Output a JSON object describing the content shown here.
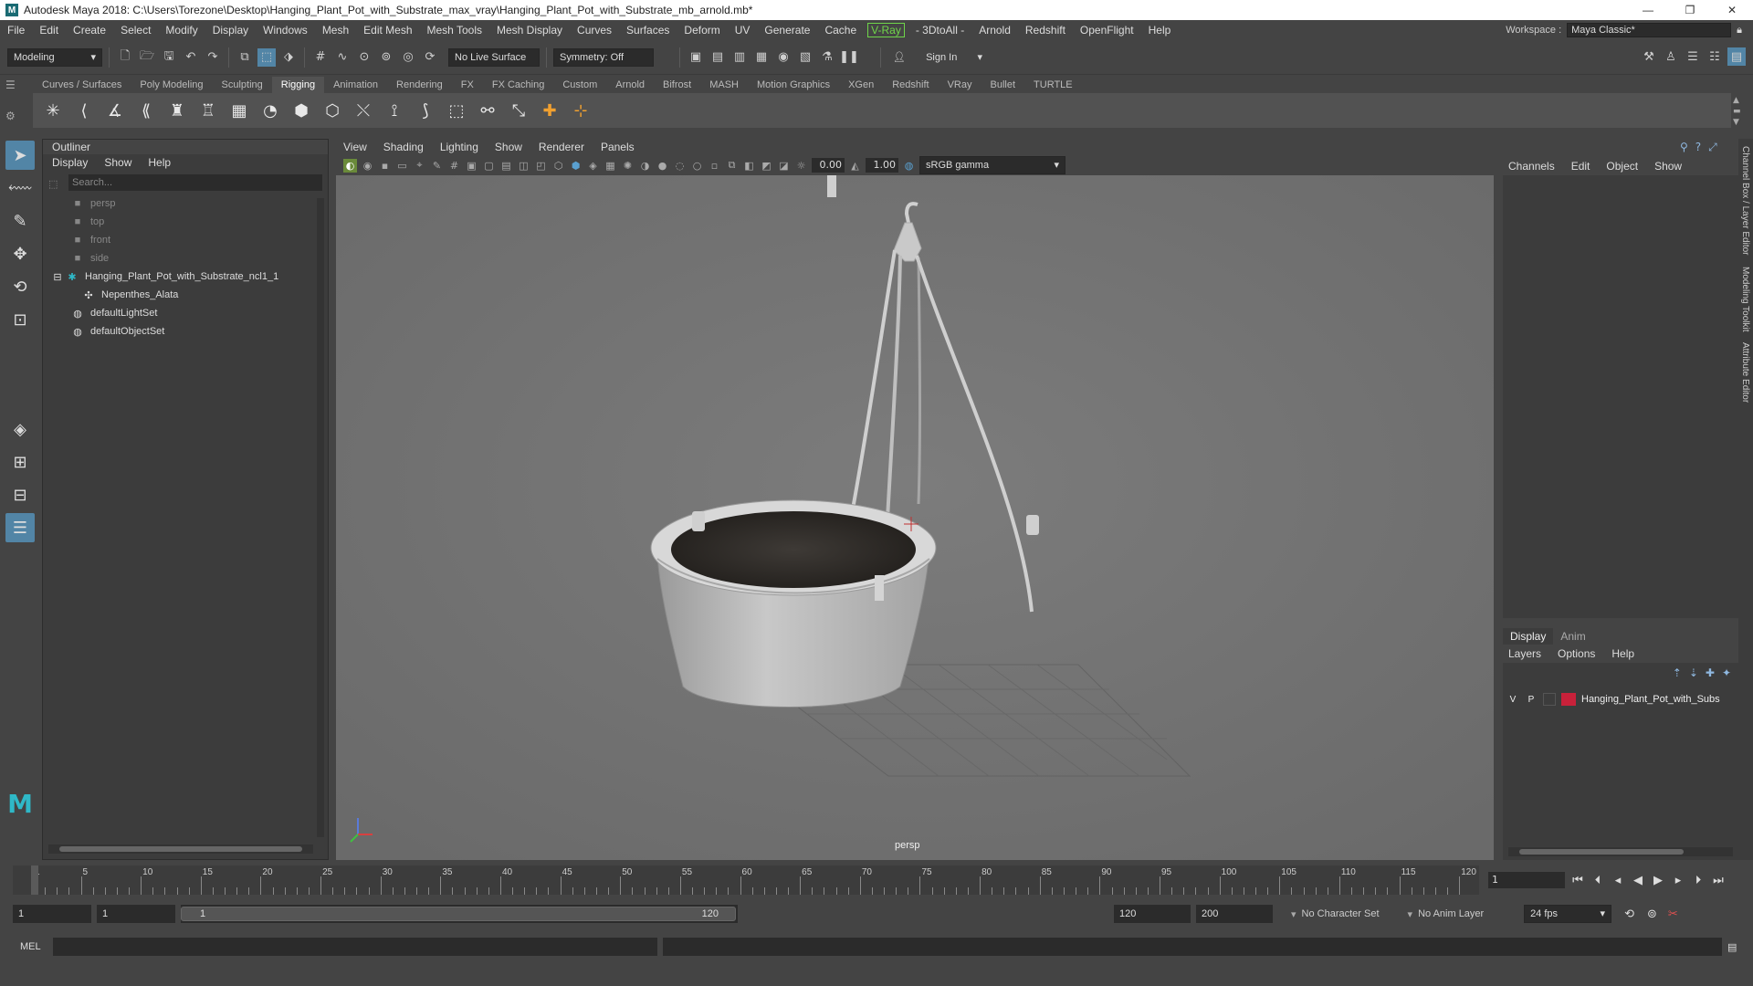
{
  "window": {
    "title": "Autodesk Maya 2018: C:\\Users\\Torezone\\Desktop\\Hanging_Plant_Pot_with_Substrate_max_vray\\Hanging_Plant_Pot_with_Substrate_mb_arnold.mb*",
    "min": "—",
    "max": "❐",
    "close": "✕"
  },
  "menubar": {
    "items": [
      "File",
      "Edit",
      "Create",
      "Select",
      "Modify",
      "Display",
      "Windows",
      "Mesh",
      "Edit Mesh",
      "Mesh Tools",
      "Mesh Display",
      "Curves",
      "Surfaces",
      "Deform",
      "UV",
      "Generate",
      "Cache"
    ],
    "vray": "V-Ray",
    "items2": [
      "- 3DtoAll -",
      "Arnold",
      "Redshift",
      "OpenFlight",
      "Help"
    ],
    "workspace_label": "Workspace :",
    "workspace_value": "Maya Classic*"
  },
  "statusline": {
    "mode": "Modeling",
    "live_surface": "No Live Surface",
    "symmetry": "Symmetry: Off",
    "sign_in": "Sign In"
  },
  "shelf": {
    "tabs": [
      "Curves / Surfaces",
      "Poly Modeling",
      "Sculpting",
      "Rigging",
      "Animation",
      "Rendering",
      "FX",
      "FX Caching",
      "Custom",
      "Arnold",
      "Bifrost",
      "MASH",
      "Motion Graphics",
      "XGen",
      "Redshift",
      "VRay",
      "Bullet",
      "TURTLE"
    ],
    "active_tab": "Rigging"
  },
  "outliner": {
    "title": "Outliner",
    "menus": [
      "Display",
      "Show",
      "Help"
    ],
    "search_placeholder": "Search...",
    "items": [
      {
        "label": "persp",
        "kind": "camera"
      },
      {
        "label": "top",
        "kind": "camera"
      },
      {
        "label": "front",
        "kind": "camera"
      },
      {
        "label": "side",
        "kind": "camera"
      },
      {
        "label": "Hanging_Plant_Pot_with_Substrate_ncl1_1",
        "kind": "group"
      },
      {
        "label": "Nepenthes_Alata",
        "kind": "mesh"
      },
      {
        "label": "defaultLightSet",
        "kind": "set"
      },
      {
        "label": "defaultObjectSet",
        "kind": "set"
      }
    ]
  },
  "viewport": {
    "menus": [
      "View",
      "Shading",
      "Lighting",
      "Show",
      "Renderer",
      "Panels"
    ],
    "exposure": "0.00",
    "gamma": "1.00",
    "color_space": "sRGB gamma",
    "camera_label": "persp"
  },
  "channelbox": {
    "menus": [
      "Channels",
      "Edit",
      "Object",
      "Show"
    ]
  },
  "layereditor": {
    "tabs": [
      "Display",
      "Anim"
    ],
    "menus": [
      "Layers",
      "Options",
      "Help"
    ],
    "layer": {
      "v": "V",
      "p": "P",
      "name": "Hanging_Plant_Pot_with_Subs",
      "color": "#c8213a"
    }
  },
  "sidetabs": [
    "Channel Box / Layer Editor",
    "Modeling Toolkit",
    "Attribute Editor"
  ],
  "timeline": {
    "labels": [
      "1",
      "5",
      "10",
      "15",
      "20",
      "25",
      "30",
      "35",
      "40",
      "45",
      "50",
      "55",
      "60",
      "65",
      "70",
      "75",
      "80",
      "85",
      "90",
      "95",
      "100",
      "105",
      "110",
      "115",
      "120"
    ],
    "current_frame": "1"
  },
  "range": {
    "start": "1",
    "anim_start": "1",
    "slider_start": "1",
    "slider_end": "120",
    "anim_end": "120",
    "end": "200",
    "character_set": "No Character Set",
    "anim_layer": "No Anim Layer",
    "fps": "24 fps"
  },
  "cmdline": {
    "label": "MEL"
  }
}
